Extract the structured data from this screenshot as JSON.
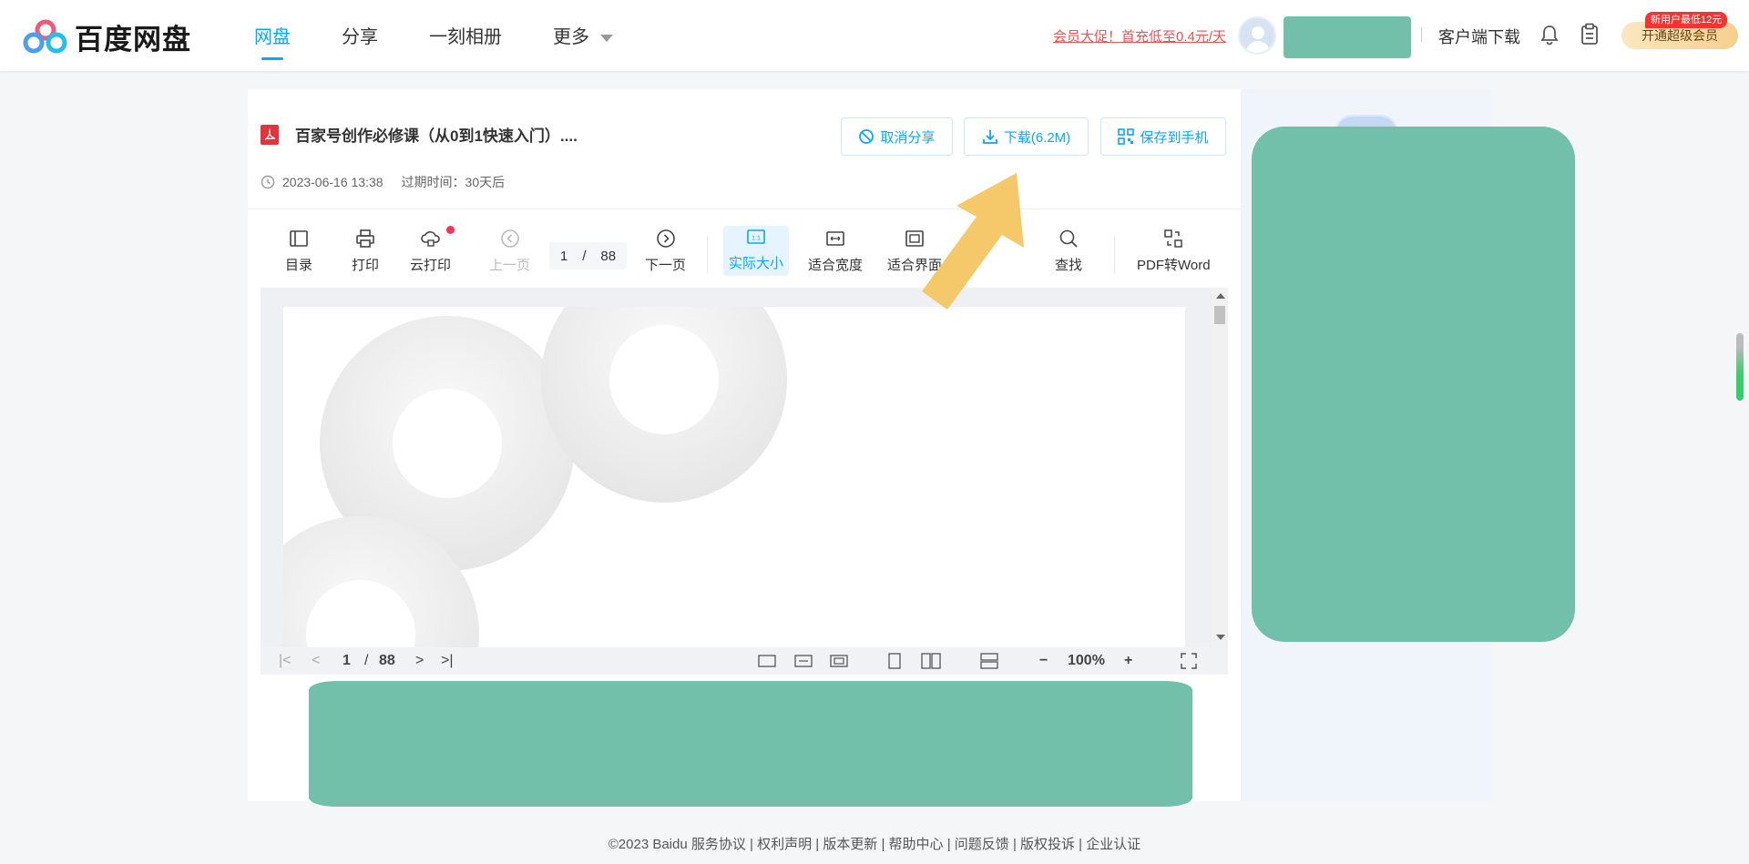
{
  "header": {
    "logo_text": "百度网盘",
    "nav": [
      "网盘",
      "分享",
      "一刻相册",
      "更多"
    ],
    "promo": "会员大促！首充低至0.4元/天",
    "client_download": "客户端下载",
    "vip_button": "开通超级会员",
    "vip_badge": "新用户最低12元"
  },
  "file": {
    "title": "百家号创作必修课（从0到1快速入门）....",
    "date": "2023-06-16 13:38",
    "expire": "过期时间：30天后",
    "actions": {
      "cancel_share": "取消分享",
      "download": "下载(6.2M)",
      "save_phone": "保存到手机"
    }
  },
  "toolbar": {
    "toc": "目录",
    "print": "打印",
    "cloud_print": "云打印",
    "prev": "上一页",
    "page_current": "1",
    "page_sep": "/",
    "page_total": "88",
    "next": "下一页",
    "actual_size": "实际大小",
    "fit_width": "适合宽度",
    "fit_page": "适合界面",
    "find": "查找",
    "pdf_to_word": "PDF转Word",
    "actual_size_icon": "1:1"
  },
  "bottom_bar": {
    "page_current": "1",
    "page_sep": "/",
    "page_total": "88",
    "zoom": "100%"
  },
  "footer": "©2023 Baidu  服务协议 | 权利声明 | 版本更新 | 帮助中心 | 问题反馈 | 版权投诉 | 企业认证",
  "colors": {
    "accent": "#06a7ff",
    "promo": "#f0504f",
    "redaction": "#72c0a9",
    "arrow": "#f5c86a"
  }
}
